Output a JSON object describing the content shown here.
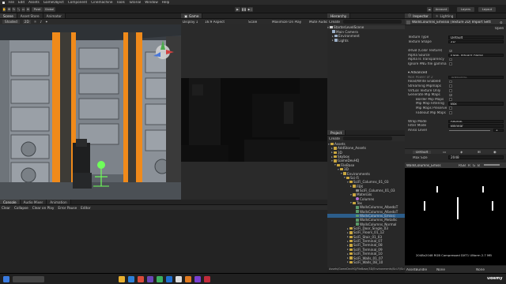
{
  "menu": [
    "File",
    "Edit",
    "Assets",
    "GameObject",
    "Component",
    "Cinemachine",
    "Tools",
    "Tutorial",
    "Window",
    "Help"
  ],
  "toolbar": {
    "pivot": "Pivot",
    "global": "Global",
    "account": "Account",
    "layers": "Layers",
    "layout": "Layout",
    "colors": {
      "accent": "#3a79d6"
    }
  },
  "scene": {
    "tabs": [
      "Scene",
      "Asset Store",
      "Animator"
    ],
    "mode": "Shaded",
    "dim": "2D"
  },
  "game": {
    "tab": "Game",
    "display": "Display 1",
    "aspect": "16:9 Aspect",
    "scale": "Scale",
    "max_on_play": "Maximize On Play",
    "mute": "Mute Audio"
  },
  "hierarchy": {
    "tab": "Hierarchy",
    "create": "Create",
    "scene_name": "StarterLevelScene",
    "items": [
      {
        "label": "Main Camera",
        "depth": 1
      },
      {
        "label": "Environment",
        "depth": 1
      },
      {
        "label": "Lights",
        "depth": 1
      }
    ]
  },
  "project": {
    "tab": "Project",
    "create": "Create",
    "items": [
      {
        "label": "Assets",
        "depth": 0,
        "kind": "folder",
        "open": true
      },
      {
        "label": "AddStone_Assets",
        "depth": 1,
        "kind": "folder"
      },
      {
        "label": "3D",
        "depth": 1,
        "kind": "folder"
      },
      {
        "label": "Skybox",
        "depth": 1,
        "kind": "folder"
      },
      {
        "label": "GameDevHQ",
        "depth": 1,
        "kind": "folder",
        "open": true
      },
      {
        "label": "FileBase",
        "depth": 2,
        "kind": "folder",
        "open": true
      },
      {
        "label": "3D",
        "depth": 3,
        "kind": "folder",
        "open": true
      },
      {
        "label": "Environments",
        "depth": 4,
        "kind": "folder",
        "open": true
      },
      {
        "label": "Sci-Fi",
        "depth": 5,
        "kind": "folder",
        "open": true
      },
      {
        "label": "SciFi_Columns_01_03",
        "depth": 6,
        "kind": "folder",
        "open": true
      },
      {
        "label": "FBX",
        "depth": 7,
        "kind": "folder"
      },
      {
        "label": "SciFi_Columns_01_03",
        "depth": 8,
        "kind": "mesh"
      },
      {
        "label": "Materials",
        "depth": 7,
        "kind": "folder",
        "open": true
      },
      {
        "label": "Columns",
        "depth": 8,
        "kind": "mat"
      },
      {
        "label": "Tex",
        "depth": 7,
        "kind": "folder",
        "open": true
      },
      {
        "label": "WallsColumns_AlbedoT",
        "depth": 8,
        "kind": "tex"
      },
      {
        "label": "WallsColumns_AlbedoT",
        "depth": 8,
        "kind": "tex"
      },
      {
        "label": "WallsColumns_Emissi",
        "depth": 8,
        "kind": "tex",
        "selected": true
      },
      {
        "label": "WallsColumns_Metallic",
        "depth": 8,
        "kind": "tex"
      },
      {
        "label": "WallsColumns_Normal",
        "depth": 8,
        "kind": "tex"
      },
      {
        "label": "SciFi_Door_Single_03",
        "depth": 6,
        "kind": "folder"
      },
      {
        "label": "SciFi_Floors_01_12",
        "depth": 6,
        "kind": "folder"
      },
      {
        "label": "SciFi_Stair_01_03",
        "depth": 6,
        "kind": "folder"
      },
      {
        "label": "SciFi_Terminal_07",
        "depth": 6,
        "kind": "folder"
      },
      {
        "label": "SciFi_Terminal_08",
        "depth": 6,
        "kind": "folder"
      },
      {
        "label": "SciFi_Terminal_09",
        "depth": 6,
        "kind": "folder"
      },
      {
        "label": "SciFi_Terminal_10",
        "depth": 6,
        "kind": "folder"
      },
      {
        "label": "SciFi_Walls_01_07",
        "depth": 6,
        "kind": "folder"
      },
      {
        "label": "SciFi_Walls_08_10",
        "depth": 6,
        "kind": "folder"
      }
    ],
    "path": "Assets/GameDevHQ/FileBase/3D/Environments/Sci-Fi/SciFi_Columns_01_03/Tex/WallsColumns_Emissi"
  },
  "console": {
    "tabs": [
      "Console",
      "Audio Mixer",
      "Animation"
    ],
    "buttons": [
      "Clear",
      "Collapse",
      "Clear on Play",
      "Error Pause",
      "Editor"
    ]
  },
  "inspector": {
    "tabs": [
      "Inspector",
      "Lighting"
    ],
    "title": "WallsColumns_Emissio (Texture 2D) Import Settings",
    "open": "Open",
    "fields": [
      {
        "label": "Texture Type",
        "value": "Default",
        "kind": "dropdown"
      },
      {
        "label": "Texture Shape",
        "value": "2D",
        "kind": "dropdown"
      },
      {
        "label": "",
        "value": "",
        "kind": "spacer"
      },
      {
        "label": "sRGB (Color Texture)",
        "value": "✓",
        "kind": "check"
      },
      {
        "label": "Alpha Source",
        "value": "Input Texture Alpha",
        "kind": "dropdown"
      },
      {
        "label": "Alpha Is Transparency",
        "value": "",
        "kind": "check"
      },
      {
        "label": "Ignore PNG file gamma",
        "value": "",
        "kind": "check"
      },
      {
        "label": "",
        "value": "",
        "kind": "spacer"
      },
      {
        "label": "▾ Advanced",
        "value": "",
        "kind": "header"
      },
      {
        "label": "Non Power of 2",
        "value": "ToNearest",
        "kind": "dropdown",
        "dim": true
      },
      {
        "label": "Read/Write Enabled",
        "value": "",
        "kind": "check"
      },
      {
        "label": "Streaming Mipmaps",
        "value": "",
        "kind": "check"
      },
      {
        "label": "Virtual Texture Only",
        "value": "",
        "kind": "check"
      },
      {
        "label": "Generate Mip Maps",
        "value": "✓",
        "kind": "check"
      },
      {
        "label": "Border Mip Maps",
        "value": "",
        "kind": "check",
        "indent": true
      },
      {
        "label": "Mip Map Filtering",
        "value": "Box",
        "kind": "dropdown",
        "indent": true
      },
      {
        "label": "Mip Maps Preserve",
        "value": "",
        "kind": "check",
        "indent": true
      },
      {
        "label": "Fadeout Mip Maps",
        "value": "",
        "kind": "check",
        "indent": true
      },
      {
        "label": "",
        "value": "",
        "kind": "spacer"
      },
      {
        "label": "Wrap Mode",
        "value": "Repeat",
        "kind": "dropdown"
      },
      {
        "label": "Filter Mode",
        "value": "Bilinear",
        "kind": "dropdown"
      },
      {
        "label": "Aniso Level",
        "value": "1",
        "kind": "slider"
      }
    ],
    "platform": {
      "default": "Default",
      "max_size_label": "Max Size",
      "max_size": "2048"
    },
    "preview": {
      "name": "WallsColumns_Emiss",
      "channels": [
        "RGB",
        "R",
        "G",
        "B"
      ],
      "info": "2048x2048  RGB Compressed DXT1 UNorm   2.7 MB",
      "asset_bundle": "AssetBundle",
      "bundle_value": "None"
    }
  },
  "taskbar": {
    "udemy": "Udemy"
  }
}
